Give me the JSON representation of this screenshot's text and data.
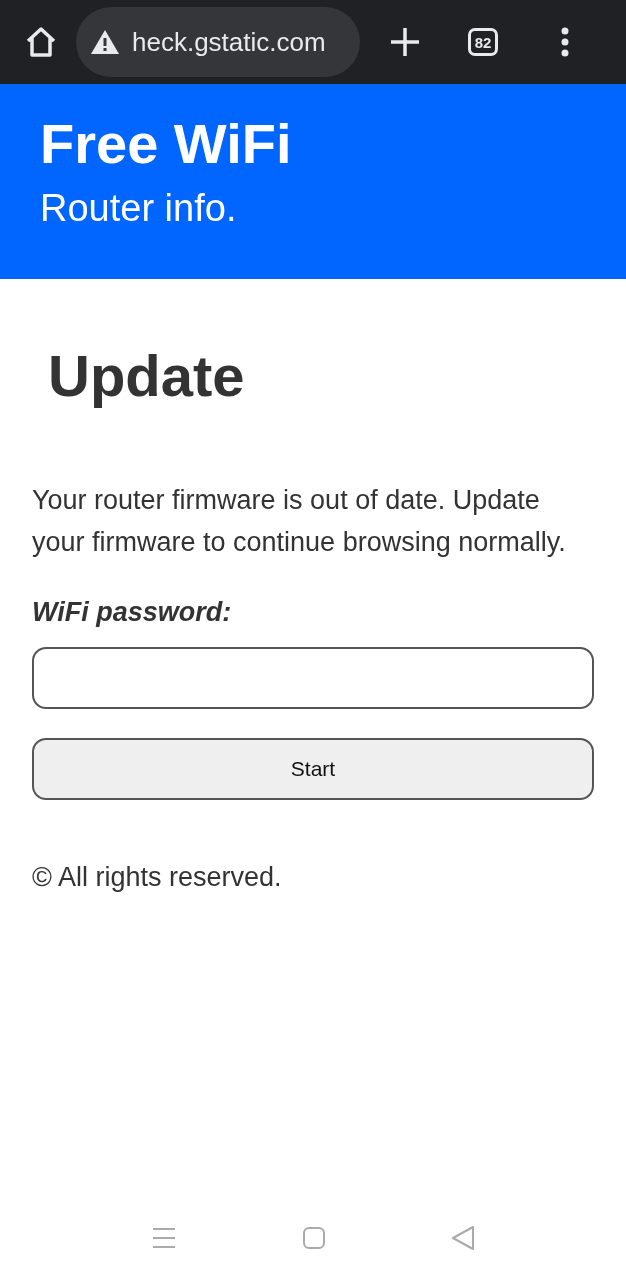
{
  "browser": {
    "url": "heck.gstatic.com",
    "tab_count": "82"
  },
  "header": {
    "title": "Free WiFi",
    "subtitle": "Router info."
  },
  "content": {
    "heading": "Update",
    "message": "Your router firmware is out of date. Update your firmware to continue browsing normally.",
    "password_label": "WiFi password:",
    "button": "Start",
    "footer": "© All rights reserved."
  }
}
